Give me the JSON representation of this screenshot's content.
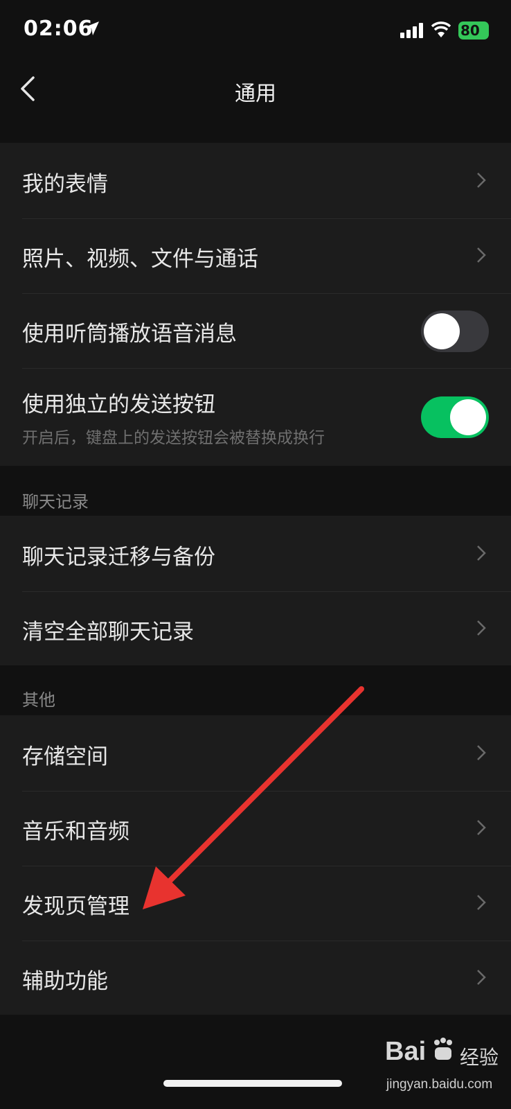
{
  "status_bar": {
    "time": "02:06",
    "battery": "80",
    "icons": [
      "location-arrow-icon",
      "cellular-signal-icon",
      "wifi-icon",
      "battery-charging-icon"
    ]
  },
  "nav": {
    "title": "通用",
    "back_icon": "chevron-left-icon"
  },
  "section1": {
    "items": [
      {
        "label": "我的表情"
      },
      {
        "label": "照片、视频、文件与通话"
      },
      {
        "label": "使用听筒播放语音消息",
        "toggle": false
      },
      {
        "label": "使用独立的发送按钮",
        "sub": "开启后，键盘上的发送按钮会被替换成换行",
        "toggle": true
      }
    ]
  },
  "section2": {
    "header": "聊天记录",
    "items": [
      {
        "label": "聊天记录迁移与备份"
      },
      {
        "label": "清空全部聊天记录"
      }
    ]
  },
  "section3": {
    "header": "其他",
    "items": [
      {
        "label": "存储空间"
      },
      {
        "label": "音乐和音频"
      },
      {
        "label": "发现页管理"
      },
      {
        "label": "辅助功能"
      }
    ]
  },
  "watermark": {
    "brand": "Bai",
    "brand2": "经验",
    "url": "jingyan.baidu.com"
  },
  "colors": {
    "background": "#111111",
    "cell": "#1c1c1c",
    "toggle_on": "#07c160",
    "annotation_arrow": "#e8332f"
  }
}
